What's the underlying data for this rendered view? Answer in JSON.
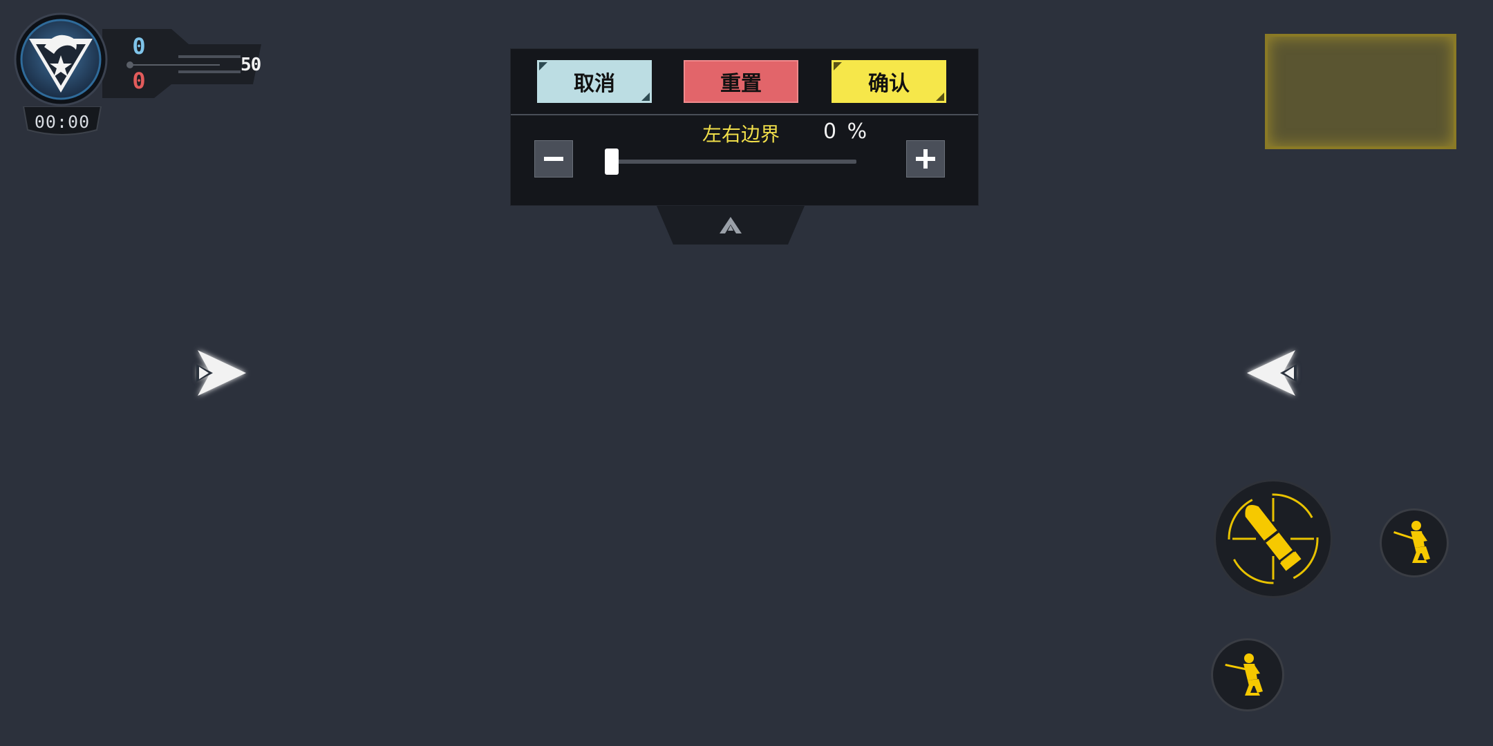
{
  "hud": {
    "timer": "00:00",
    "team_blue_score": "0",
    "team_red_score": "0",
    "target_score": "50",
    "emblem_icon": "eagle-star-emblem-icon"
  },
  "settings_panel": {
    "cancel_label": "取消",
    "reset_label": "重置",
    "confirm_label": "确认",
    "setting_label": "左右边界",
    "setting_value": "0 %",
    "slider_value_percent": 0,
    "minus_icon": "minus-icon",
    "plus_icon": "plus-icon",
    "collapse_icon": "chevron-up-icon"
  },
  "controls": {
    "left_arrow_icon": "double-chevron-right-icon",
    "right_arrow_icon": "double-chevron-left-icon",
    "fire_icon": "bullet-crosshair-icon",
    "crouch_icon": "kneeling-soldier-icon",
    "prone_icon": "kneeling-soldier-icon"
  },
  "colors": {
    "background": "#2c313c",
    "accent_yellow": "#f6c900",
    "team_blue": "#7fc4ea",
    "team_red": "#e25b5b",
    "cancel_button": "#bcdde3",
    "reset_button": "#e2656a",
    "confirm_button": "#f6e74a"
  }
}
